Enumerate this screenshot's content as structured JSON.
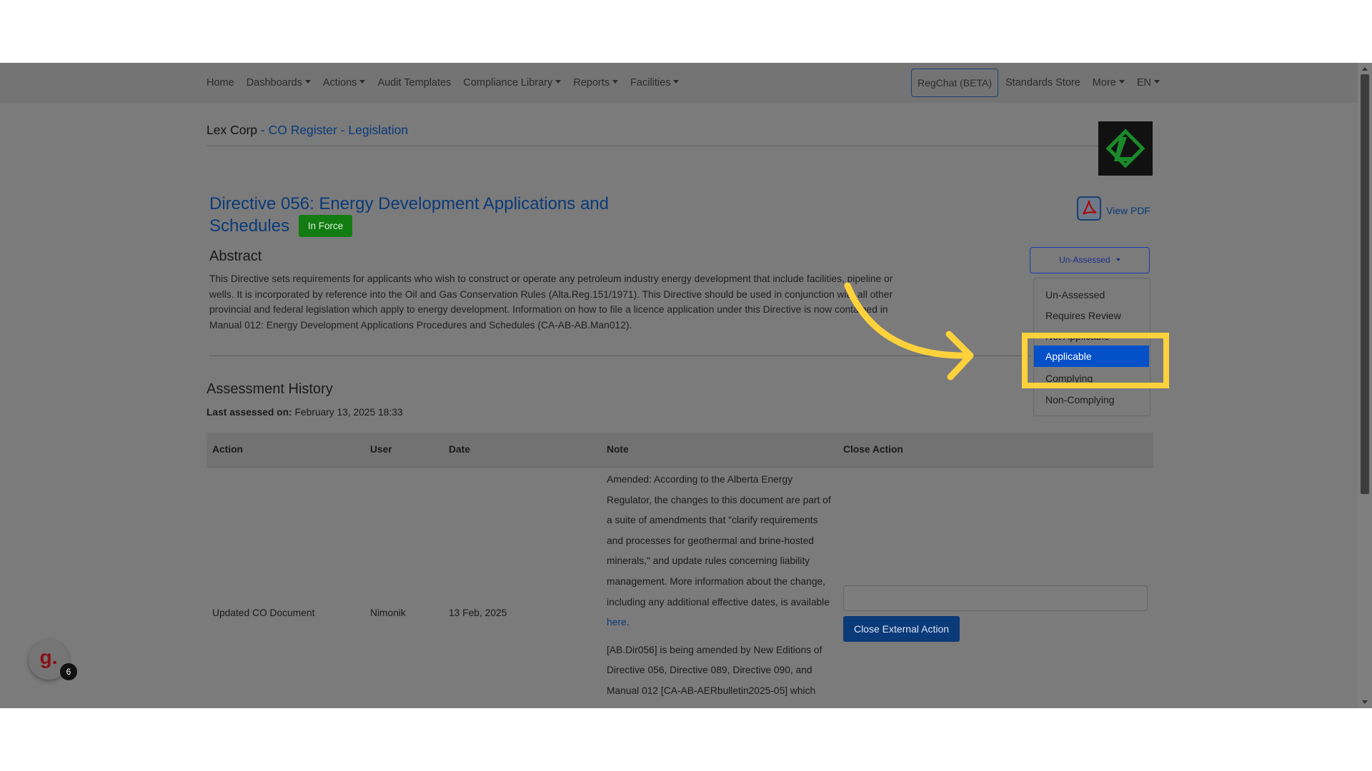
{
  "nav": {
    "home": "Home",
    "dashboards": "Dashboards",
    "actions": "Actions",
    "audit_templates": "Audit Templates",
    "compliance_library": "Compliance Library",
    "reports": "Reports",
    "facilities": "Facilities",
    "regchat": "RegChat (BETA)",
    "standards_store": "Standards Store",
    "more": "More",
    "language": "EN"
  },
  "breadcrumb": {
    "company": "Lex Corp",
    "separator1": " - ",
    "register": "CO Register",
    "separator2": " - ",
    "section": "Legislation"
  },
  "document": {
    "title": "Directive 056: Energy Development Applications and Schedules",
    "status_badge": "In Force",
    "view_pdf": "View PDF",
    "abstract_heading": "Abstract",
    "abstract_text": "This Directive sets requirements for applicants who wish to construct or operate any petroleum industry energy development that include facilities, pipeline or wells. It is incorporated by reference into the Oil and Gas Conservation Rules (Alta.Reg.151/1971). This Directive should be used in conjunction with all other provincial and federal legislation which apply to energy development. Information on how to file a licence application under this Directive is now contained in Manual 012: Energy Development Applications Procedures and Schedules (CA-AB-AB.Man012)."
  },
  "status_dropdown": {
    "button_label": "Un-Assessed",
    "options": [
      "Un-Assessed",
      "Requires Review",
      "Not Applicable",
      "Applicable",
      "Complying",
      "Non-Complying"
    ],
    "selected": "Applicable"
  },
  "history": {
    "title": "Assessment History",
    "last_assessed_label": "Last assessed on:",
    "last_assessed_value": "February 13, 2025 18:33",
    "columns": [
      "Action",
      "User",
      "Date",
      "Note",
      "Close Action"
    ],
    "rows": [
      {
        "action": "Updated CO Document",
        "user": "Nimonik",
        "date": "13 Feb, 2025",
        "note_p1": "Amended: According to the Alberta Energy Regulator, the changes to this document are part of a suite of amendments that \"clarify requirements and processes for geothermal and brine-hosted minerals,\" and update rules concerning liability management. More information about the change, including any additional effective dates, is available",
        "note_link": "here",
        "note_p1_end": ".",
        "note_p2": "[AB.Dir056] is being amended by New Editions of Directive 056, Directive 089, Directive 090, and Manual 012 [CA-AB-AERbulletin2025-05] which",
        "close_action_button": "Close External Action"
      }
    ]
  },
  "chat_widget": {
    "glyph": "g.",
    "count": "6"
  },
  "colors": {
    "overlay": "#7b7b7b",
    "link": "#0b3a78",
    "badge_green": "#127c12",
    "dropdown_active": "#0450c9",
    "highlight_yellow": "#ffd23c"
  }
}
